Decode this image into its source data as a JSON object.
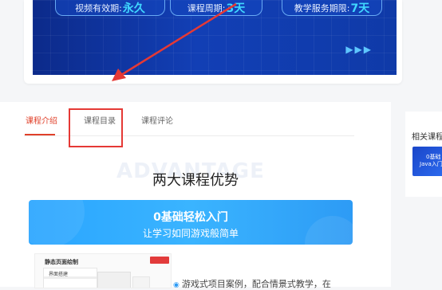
{
  "banner": {
    "stats": [
      {
        "label": "视频有效期:",
        "value": "永久"
      },
      {
        "label": "课程周期:",
        "value": "3天"
      },
      {
        "label": "教学服务期限:",
        "value": "7天"
      }
    ],
    "arrows": "▶▶▶"
  },
  "tabs": [
    {
      "label": "课程介绍",
      "active": true
    },
    {
      "label": "课程目录",
      "active": false
    },
    {
      "label": "课程评论",
      "active": false
    }
  ],
  "content": {
    "watermark": "ADVANTAGE",
    "section_title": "两大课程优势",
    "advantage": {
      "headline": "0基础轻松入门",
      "subline": "让学习如同游戏般简单"
    },
    "thumbnail": {
      "title": "静态页面绘制",
      "window_title": "界面搭建"
    },
    "bullet_text": "游戏式项目案例，配合情景式教学，在"
  },
  "sidebar": {
    "title": "相关课程",
    "course_line1": "0基础",
    "course_line2": "Java入门"
  },
  "colors": {
    "accent_red": "#e0402a",
    "highlight_red": "#e53935",
    "banner_blue": "#123fb5",
    "advantage_blue": "#2d9bf5",
    "stat_value_cyan": "#40d8ff"
  }
}
